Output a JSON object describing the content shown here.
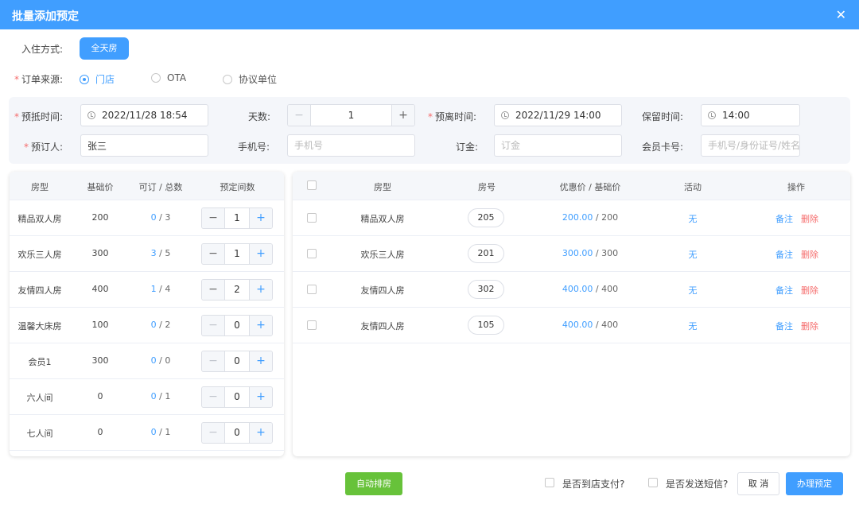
{
  "dialog": {
    "title": "批量添加预定",
    "close_icon": "✕"
  },
  "checkin": {
    "label": "入住方式:",
    "option": "全天房"
  },
  "source": {
    "label": "订单来源:",
    "options": [
      {
        "label": "门店",
        "selected": true
      },
      {
        "label": "OTA",
        "selected": false
      },
      {
        "label": "协议单位",
        "selected": false
      }
    ]
  },
  "form": {
    "arrive_label": "预抵时间:",
    "arrive_value": "2022/11/28 18:54",
    "days_label": "天数:",
    "days_value": "1",
    "depart_label": "预离时间:",
    "depart_value": "2022/11/29 14:00",
    "hold_label": "保留时间:",
    "hold_value": "14:00",
    "booker_label": "预订人:",
    "booker_value": "张三",
    "phone_label": "手机号:",
    "phone_placeholder": "手机号",
    "deposit_label": "订金:",
    "deposit_placeholder": "订金",
    "member_label": "会员卡号:",
    "member_placeholder": "手机号/身份证号/姓名"
  },
  "left_table": {
    "headers": [
      "房型",
      "基础价",
      "可订 / 总数",
      "预定间数"
    ],
    "rows": [
      {
        "type": "精品双人房",
        "price": "200",
        "avail": "0",
        "total": "3",
        "count": "1"
      },
      {
        "type": "欢乐三人房",
        "price": "300",
        "avail": "3",
        "total": "5",
        "count": "1"
      },
      {
        "type": "友情四人房",
        "price": "400",
        "avail": "1",
        "total": "4",
        "count": "2"
      },
      {
        "type": "温馨大床房",
        "price": "100",
        "avail": "0",
        "total": "2",
        "count": "0"
      },
      {
        "type": "会员1",
        "price": "300",
        "avail": "0",
        "total": "0",
        "count": "0"
      },
      {
        "type": "六人间",
        "price": "0",
        "avail": "0",
        "total": "1",
        "count": "0"
      },
      {
        "type": "七人间",
        "price": "0",
        "avail": "0",
        "total": "1",
        "count": "0"
      }
    ]
  },
  "right_table": {
    "headers": [
      "房型",
      "房号",
      "优惠价 / 基础价",
      "活动",
      "操作"
    ],
    "rows": [
      {
        "type": "精品双人房",
        "room": "205",
        "discount": "200.00",
        "base": "200",
        "activity": "无",
        "note": "备注",
        "delete": "删除"
      },
      {
        "type": "欢乐三人房",
        "room": "201",
        "discount": "300.00",
        "base": "300",
        "activity": "无",
        "note": "备注",
        "delete": "删除"
      },
      {
        "type": "友情四人房",
        "room": "302",
        "discount": "400.00",
        "base": "400",
        "activity": "无",
        "note": "备注",
        "delete": "删除"
      },
      {
        "type": "友情四人房",
        "room": "105",
        "discount": "400.00",
        "base": "400",
        "activity": "无",
        "note": "备注",
        "delete": "删除"
      }
    ]
  },
  "footer": {
    "auto_assign": "自动排房",
    "pay_at_store": "是否到店支付?",
    "send_sms": "是否发送短信?",
    "cancel": "取 消",
    "submit": "办理预定"
  },
  "colors": {
    "primary": "#409eff",
    "danger": "#f56c6c",
    "success": "#67c23a"
  }
}
